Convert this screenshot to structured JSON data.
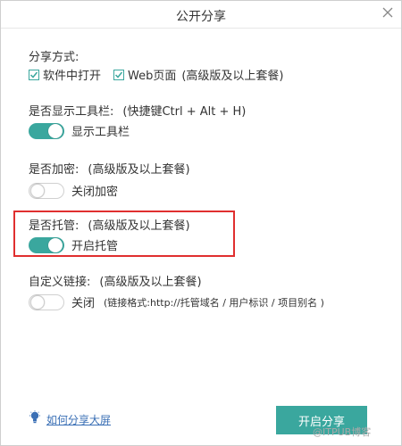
{
  "dialog": {
    "title": "公开分享"
  },
  "share_method": {
    "label": "分享方式:",
    "options": [
      {
        "label": "软件中打开",
        "checked": true
      },
      {
        "label": "Web页面",
        "note": "(高级版及以上套餐)",
        "checked": true
      }
    ]
  },
  "toolbar": {
    "label": "是否显示工具栏:",
    "note": "(快捷键Ctrl + Alt + H)",
    "toggle_label": "显示工具栏",
    "on": true
  },
  "encrypt": {
    "label": "是否加密:",
    "note": "(高级版及以上套餐)",
    "toggle_label": "关闭加密",
    "on": false
  },
  "hosting": {
    "label": "是否托管:",
    "note": "(高级版及以上套餐)",
    "toggle_label": "开启托管",
    "on": true
  },
  "custom_link": {
    "label": "自定义链接:",
    "note": "(高级版及以上套餐)",
    "toggle_label": "关闭",
    "hint": "(链接格式:http://托管域名 / 用户标识 / 项目别名 )",
    "on": false
  },
  "footer": {
    "help_link": "如何分享大屏",
    "submit_label": "开启分享"
  },
  "watermark": {
    "text": "@ITPUB博客"
  },
  "colors": {
    "accent": "#3aa79e",
    "highlight": "#e02f2f",
    "link": "#3a6fb5"
  }
}
